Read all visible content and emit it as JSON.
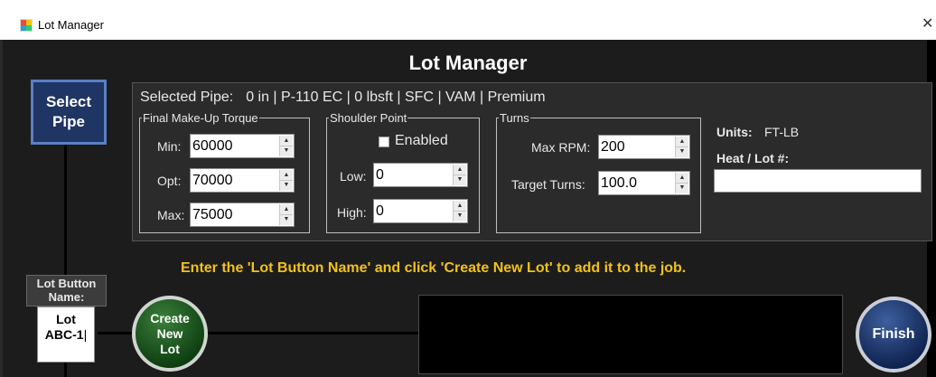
{
  "window": {
    "title": "Lot Manager",
    "close_glyph": "✕"
  },
  "header": {
    "title": "Lot Manager"
  },
  "select_pipe": {
    "label": "Select Pipe"
  },
  "selected_pipe": {
    "label": "Selected Pipe:",
    "value": "0 in | P-110 EC | 0 lbsft | SFC | VAM | Premium"
  },
  "torque": {
    "title": "Final Make-Up Torque",
    "min_label": "Min:",
    "min_value": "60000",
    "opt_label": "Opt:",
    "opt_value": "70000",
    "max_label": "Max:",
    "max_value": "75000"
  },
  "shoulder": {
    "title": "Shoulder Point",
    "enabled_label": "Enabled",
    "enabled_checked": false,
    "low_label": "Low:",
    "low_value": "0",
    "high_label": "High:",
    "high_value": "0"
  },
  "turns": {
    "title": "Turns",
    "max_rpm_label": "Max RPM:",
    "max_rpm_value": "200",
    "target_label": "Target Turns:",
    "target_value": "100.0"
  },
  "units": {
    "label": "Units:",
    "value": "FT-LB"
  },
  "heat_lot": {
    "label": "Heat / Lot #:",
    "value": ""
  },
  "instruction": "Enter the 'Lot Button Name' and click 'Create New Lot' to add it to the job.",
  "lot_button_name": {
    "label": "Lot Button Name:",
    "value": "Lot\nABC-1"
  },
  "create_button": {
    "label": "Create\nNew\nLot"
  },
  "finish_button": {
    "label": "Finish"
  },
  "spinner": {
    "up": "▲",
    "down": "▼"
  },
  "colors": {
    "background": "#1c1c1c",
    "panel": "#2b2b2b",
    "instruction_text": "#f2c21b",
    "select_pipe_border": "#5b7fc4",
    "create_button": "#1f5a20",
    "finish_button": "#1a3470"
  },
  "icons": {
    "app": "window-grid-icon",
    "close": "close-icon"
  }
}
